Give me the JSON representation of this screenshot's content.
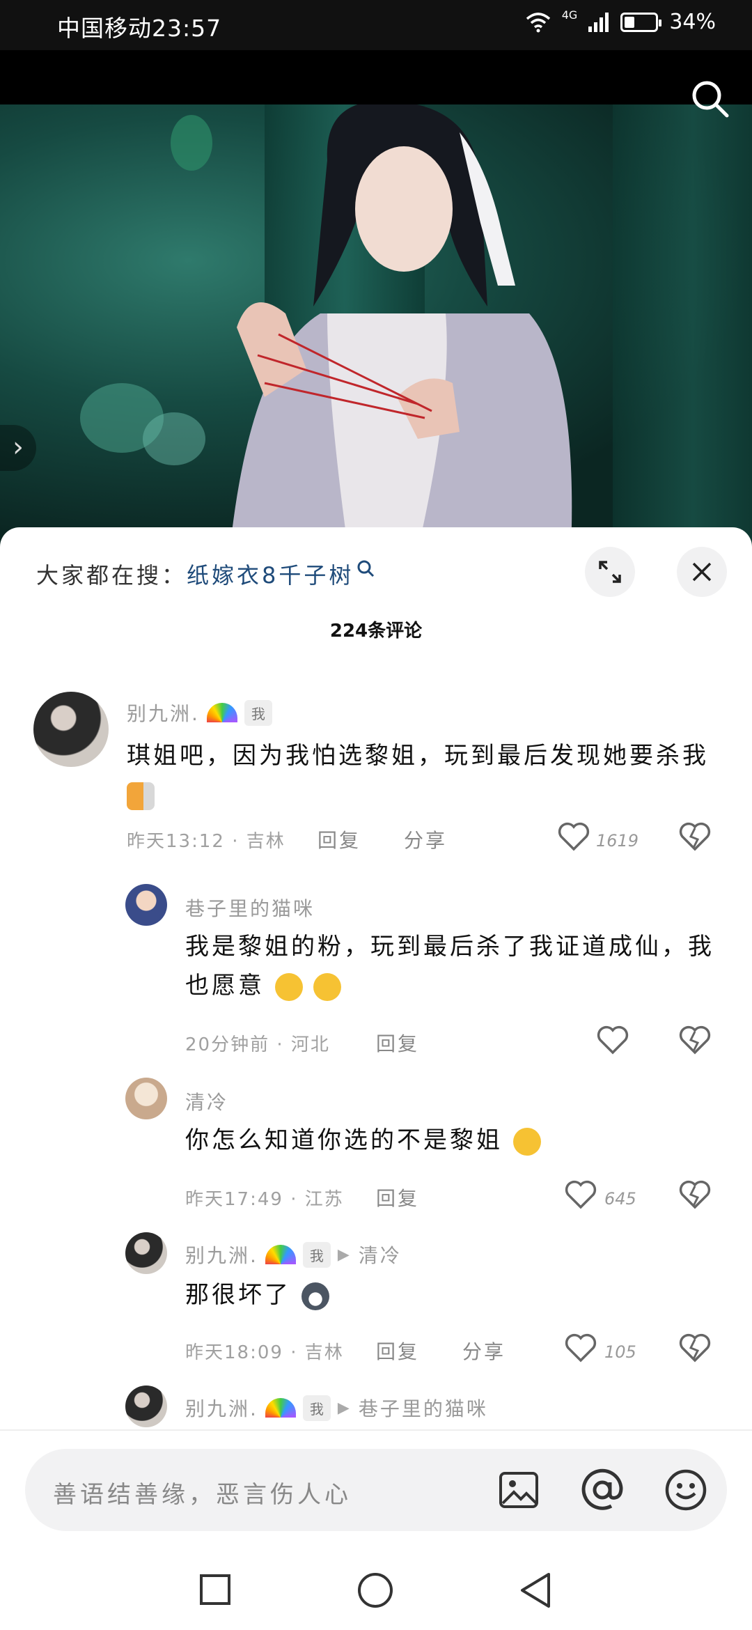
{
  "status": {
    "carrier": "中国移动",
    "time": "23:57",
    "network": "4G",
    "battery": "34%"
  },
  "sheet": {
    "hot_search_label": "大家都在搜：",
    "hot_search_keyword": "纸嫁衣8千子树",
    "comment_count": "224条评论"
  },
  "comments": [
    {
      "user": "别九洲.",
      "me_tag": "我",
      "text": "琪姐吧，因为我怕选黎姐，玩到最后发现她要杀我",
      "time": "昨天13:12 · 吉林",
      "reply": "回复",
      "share": "分享",
      "likes": "1619"
    },
    {
      "user": "巷子里的猫咪",
      "text": "我是黎姐的粉，玩到最后杀了我证道成仙，我也愿意",
      "time": "20分钟前 · 河北",
      "reply": "回复"
    },
    {
      "user": "清冷",
      "text": "你怎么知道你选的不是黎姐",
      "time": "昨天17:49 · 江苏",
      "reply": "回复",
      "likes": "645"
    },
    {
      "user": "别九洲.",
      "me_tag": "我",
      "reply_to": "清冷",
      "text": "那很坏了",
      "time": "昨天18:09 · 吉林",
      "reply": "回复",
      "share": "分享",
      "likes": "105"
    },
    {
      "user": "别九洲.",
      "me_tag": "我",
      "reply_to": "巷子里的猫咪"
    }
  ],
  "input": {
    "placeholder": "善语结善缘，恶言伤人心"
  }
}
